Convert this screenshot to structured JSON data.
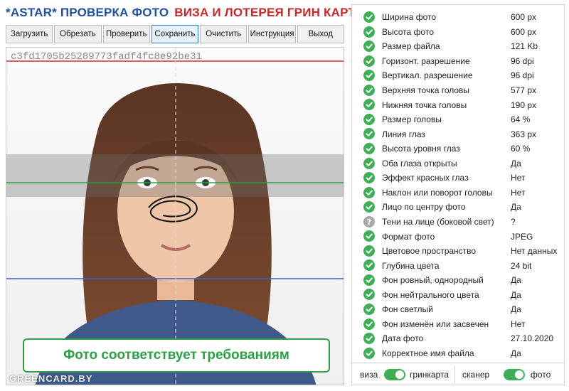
{
  "title": {
    "part1": "*ASTAR* ПРОВЕРКА ФОТО",
    "part2": "ВИЗА И ЛОТЕРЕЯ ГРИН КАРТА"
  },
  "toolbar": [
    {
      "label": "Загрузить"
    },
    {
      "label": "Обрезать"
    },
    {
      "label": "Проверить"
    },
    {
      "label": "Сохранить",
      "active": true
    },
    {
      "label": "Очистить"
    },
    {
      "label": "Инструкция"
    },
    {
      "label": "Выход"
    }
  ],
  "photo": {
    "hash": "c3fd1705b25289773fadf4fc8e92be31",
    "verdict": "Фото соответствует требованиям",
    "watermark": "GREENCARD.BY"
  },
  "checks": [
    {
      "label": "Ширина фото",
      "value": "600 px",
      "status": "ok"
    },
    {
      "label": "Высота фото",
      "value": "600 px",
      "status": "ok"
    },
    {
      "label": "Размер файла",
      "value": "121 Kb",
      "status": "ok"
    },
    {
      "label": "Горизонт. разрешение",
      "value": "96 dpi",
      "status": "ok"
    },
    {
      "label": "Вертикал. разрешение",
      "value": "96 dpi",
      "status": "ok"
    },
    {
      "label": "Верхняя точка головы",
      "value": "577 px",
      "status": "ok"
    },
    {
      "label": "Нижняя точка головы",
      "value": "190 px",
      "status": "ok"
    },
    {
      "label": "Размер головы",
      "value": "64 %",
      "status": "ok"
    },
    {
      "label": "Линия глаз",
      "value": "363 px",
      "status": "ok"
    },
    {
      "label": "Высота уровня глаз",
      "value": "60 %",
      "status": "ok"
    },
    {
      "label": "Оба глаза открыты",
      "value": "Да",
      "status": "ok"
    },
    {
      "label": "Эффект красных глаз",
      "value": "Нет",
      "status": "ok"
    },
    {
      "label": "Наклон или поворот головы",
      "value": "Нет",
      "status": "ok"
    },
    {
      "label": "Лицо по центру фото",
      "value": "Да",
      "status": "ok"
    },
    {
      "label": "Тени на лице (боковой свет)",
      "value": "?",
      "status": "unknown"
    },
    {
      "label": "Формат фото",
      "value": "JPEG",
      "status": "ok"
    },
    {
      "label": "Цветовое пространство",
      "value": "Нет данных",
      "status": "ok"
    },
    {
      "label": "Глубина цвета",
      "value": "24 bit",
      "status": "ok"
    },
    {
      "label": "Фон ровный, однородный",
      "value": "Да",
      "status": "ok"
    },
    {
      "label": "Фон нейтрального цвета",
      "value": "Да",
      "status": "ok"
    },
    {
      "label": "Фон светлый",
      "value": "Да",
      "status": "ok"
    },
    {
      "label": "Фон изменён или засвечен",
      "value": "Нет",
      "status": "ok"
    },
    {
      "label": "Дата фото",
      "value": "27.10.2020",
      "status": "ok"
    },
    {
      "label": "Корректное имя файла",
      "value": "Да",
      "status": "ok"
    }
  ],
  "toggles": {
    "left": {
      "a": "виза",
      "b": "гринкарта",
      "on": true
    },
    "right": {
      "a": "сканер",
      "b": "фото",
      "on": true
    }
  },
  "colors": {
    "ok": "#3fae57",
    "unknown": "#a9a9a9",
    "title_blue": "#1f4f9e",
    "title_red": "#c62828",
    "verdict_green": "#2e9e47"
  },
  "icons": {
    "ok": "check-circle-icon",
    "unknown": "question-circle-icon"
  }
}
